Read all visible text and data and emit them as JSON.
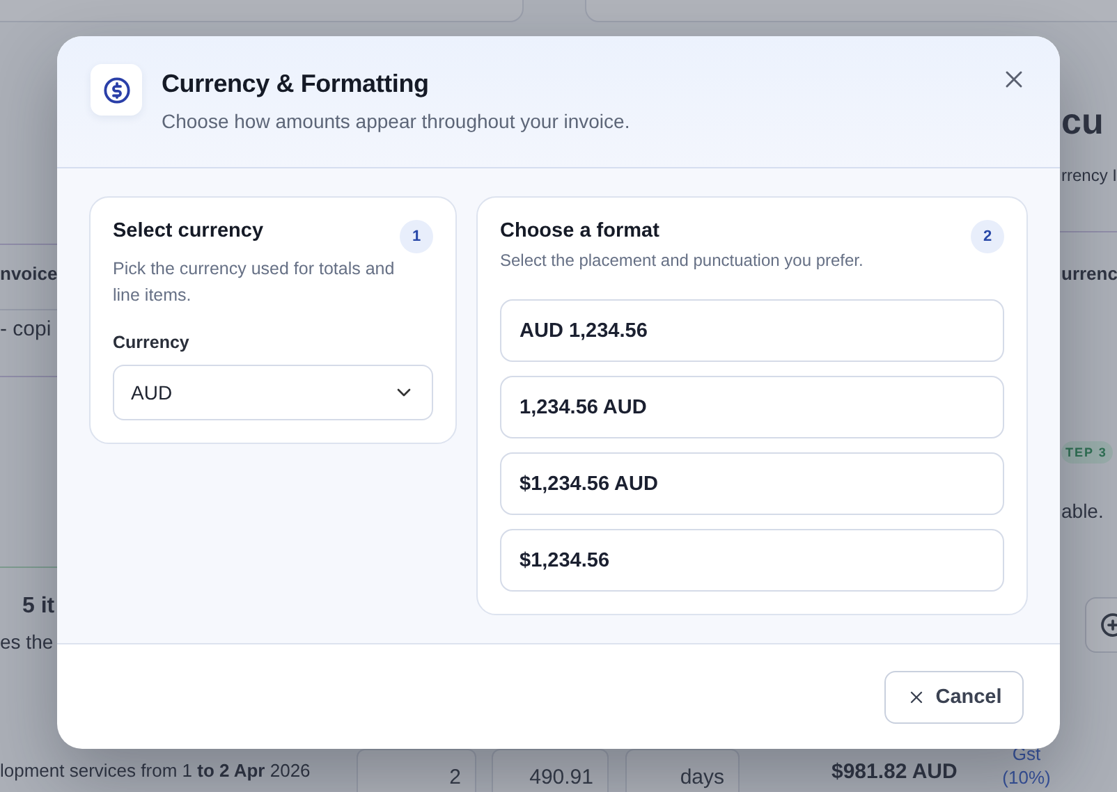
{
  "background": {
    "left": {
      "heading": "nvoice",
      "cell": "- copi",
      "count": "5 it",
      "note": "es the"
    },
    "right": {
      "title": "cu",
      "subtitle": "rrency I",
      "column": "urrenc",
      "badge": "TEP 3",
      "note": "able."
    },
    "row": {
      "description": "lopment services from 1 **to 2 Apr** 2026",
      "quantity": "2",
      "rate": "490.91",
      "unit": "days",
      "amount": "$981.82 AUD",
      "tax": "Gst (10%)"
    }
  },
  "dialog": {
    "title": "Currency & Formatting",
    "subtitle": "Choose how amounts appear throughout your invoice.",
    "currency_panel": {
      "title": "Select currency",
      "description": "Pick the currency used for totals and line items.",
      "step": "1",
      "field_label": "Currency",
      "value": "AUD"
    },
    "format_panel": {
      "title": "Choose a format",
      "description": "Select the placement and punctuation you prefer.",
      "step": "2",
      "options": [
        {
          "label": "AUD 1,234.56",
          "selected": false
        },
        {
          "label": "1,234.56 AUD",
          "selected": false
        },
        {
          "label": "$1,234.56 AUD",
          "selected": false
        },
        {
          "label": "$1,234.56",
          "selected": false
        }
      ]
    },
    "footer": {
      "cancel": "Cancel"
    }
  }
}
